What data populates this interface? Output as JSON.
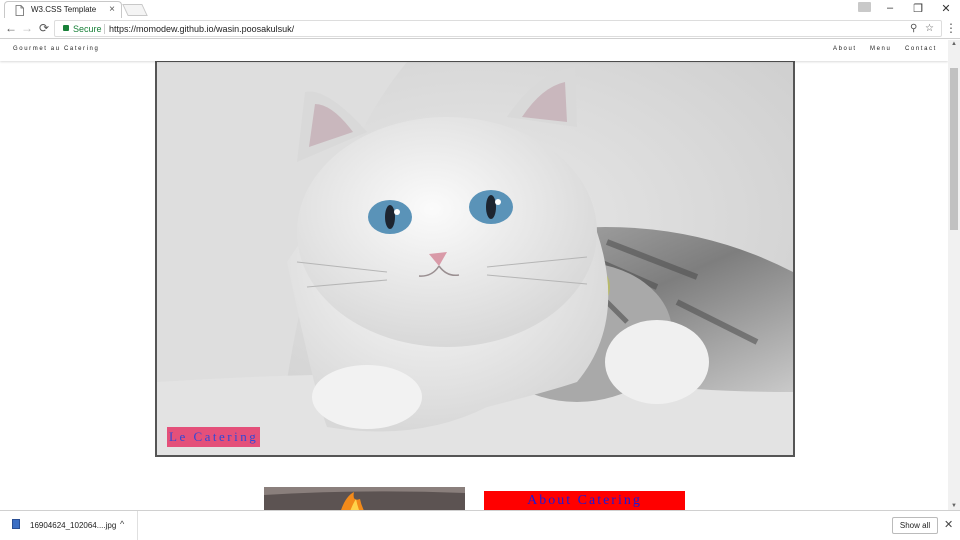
{
  "browser": {
    "tab_title": "W3.CSS Template",
    "tab_close": "×",
    "secure_label": "Secure",
    "url": "https://momodew.github.io/wasin.poosakulsuk/",
    "back": "←",
    "forward": "→",
    "reload": "⟳",
    "zoom_icon": "⚲",
    "star_icon": "☆",
    "menu_icon": "⋮",
    "minimize": "–",
    "maximize": "❐",
    "close": "✕"
  },
  "site": {
    "brand": "Gourmet au Catering",
    "nav": [
      "About",
      "Menu",
      "Contact"
    ],
    "hero_label": "Le Catering",
    "about_title": "About Catering"
  },
  "downloads": {
    "file_name": "16904624_102064....jpg",
    "chevron": "^",
    "show_all": "Show all",
    "close": "✕"
  },
  "colors": {
    "hero_label_bg": "#e4507a",
    "hero_label_text": "#3048d8",
    "about_bg": "#ff0000",
    "about_text": "#1a1ad8",
    "secure_green": "#188038"
  }
}
